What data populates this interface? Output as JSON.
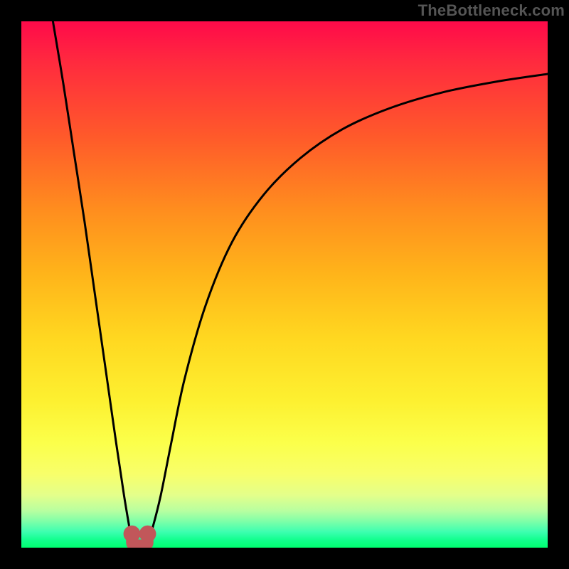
{
  "watermark": "TheBottleneck.com",
  "chart_data": {
    "type": "line",
    "title": "",
    "xlabel": "",
    "ylabel": "",
    "xlim": [
      0,
      100
    ],
    "ylim": [
      0,
      100
    ],
    "grid": false,
    "series": [
      {
        "name": "left-curve",
        "stroke": "#000000",
        "x": [
          6,
          8,
          10,
          12,
          14,
          16,
          18,
          19.5,
          20.5,
          21
        ],
        "values": [
          100,
          88,
          75,
          62,
          48,
          34,
          20,
          10,
          4,
          1
        ]
      },
      {
        "name": "right-curve",
        "stroke": "#000000",
        "x": [
          24,
          25,
          26.5,
          28.5,
          31,
          35,
          40,
          46,
          53,
          61,
          70,
          80,
          90,
          100
        ],
        "values": [
          1,
          4,
          10,
          20,
          32,
          46,
          58,
          67,
          74,
          79.5,
          83.5,
          86.5,
          88.5,
          90
        ]
      }
    ],
    "markers": [
      {
        "name": "trough-dot-left",
        "x": 21,
        "y": 1,
        "r": 1.6,
        "fill": "#c1575a"
      },
      {
        "name": "trough-dot-right",
        "x": 24,
        "y": 1,
        "r": 1.6,
        "fill": "#c1575a"
      }
    ],
    "trough": {
      "name": "trough-bracket",
      "x1": 21,
      "x2": 24,
      "y": 1,
      "stroke": "#c1575a",
      "width": 2.2
    }
  }
}
